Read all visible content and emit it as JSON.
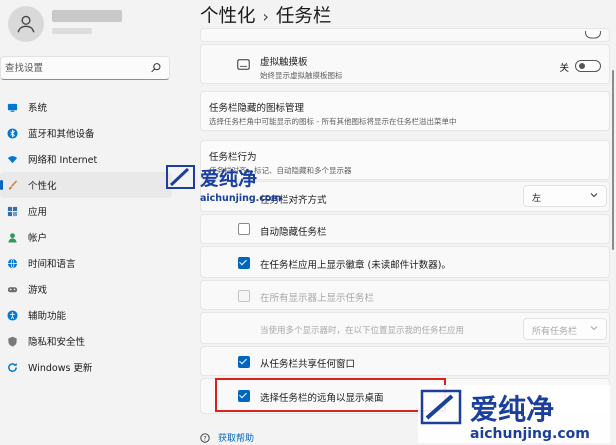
{
  "sidebar": {
    "search_placeholder": "查找设置",
    "items": [
      {
        "label": "系统",
        "icon": "system-icon",
        "color": "#0078d4"
      },
      {
        "label": "蓝牙和其他设备",
        "icon": "bluetooth-icon",
        "color": "#0078d4"
      },
      {
        "label": "网络和 Internet",
        "icon": "network-icon",
        "color": "#0078d4"
      },
      {
        "label": "个性化",
        "icon": "brush-icon",
        "color": "#d97a2b",
        "active": true
      },
      {
        "label": "应用",
        "icon": "apps-icon",
        "color": "#3a6ea5"
      },
      {
        "label": "帐户",
        "icon": "account-icon",
        "color": "#2b9a5d"
      },
      {
        "label": "时间和语言",
        "icon": "globe-icon",
        "color": "#0078d4"
      },
      {
        "label": "游戏",
        "icon": "gamepad-icon",
        "color": "#6b6b6b"
      },
      {
        "label": "辅助功能",
        "icon": "accessibility-icon",
        "color": "#0078d4"
      },
      {
        "label": "隐私和安全性",
        "icon": "shield-icon",
        "color": "#7a7a7a"
      },
      {
        "label": "Windows 更新",
        "icon": "update-icon",
        "color": "#0078d4"
      }
    ]
  },
  "breadcrumb": {
    "parent": "个性化",
    "separator": "›",
    "current": "任务栏"
  },
  "touchpad": {
    "title": "虚拟触摸板",
    "desc": "始终显示虚拟触摸板图标",
    "toggle_label": "关",
    "enabled": false
  },
  "hidden_icons": {
    "title": "任务栏隐藏的图标管理",
    "desc": "选择任务栏角中可能显示的图标 - 所有其他图标将显示在任务栏溢出菜单中"
  },
  "behaviors": {
    "title": "任务栏行为",
    "desc": "任务栏对齐、标记、自动隐藏和多个显示器",
    "alignment_label": "任务栏对齐方式",
    "alignment_value": "左",
    "auto_hide": {
      "label": "自动隐藏任务栏",
      "checked": false
    },
    "badges": {
      "label": "在任务栏应用上显示徽章 (未读邮件计数器)。",
      "checked": true
    },
    "all_displays": {
      "label": "在所有显示器上显示任务栏",
      "checked": false
    },
    "multi_display_label": "当使用多个显示器时，在以下位置显示我的任务栏应用",
    "multi_display_value": "所有任务栏",
    "share_window": {
      "label": "从任务栏共享任何窗口",
      "checked": true
    },
    "far_corner": {
      "label": "选择任务栏的远角以显示桌面",
      "checked": true
    }
  },
  "help_link": "获取帮助",
  "watermark": {
    "text": "爱纯净",
    "url": "aichunjing.com",
    "color": "#1a3f9c"
  },
  "colors": {
    "accent": "#0067c0",
    "highlight": "#d8231c"
  }
}
